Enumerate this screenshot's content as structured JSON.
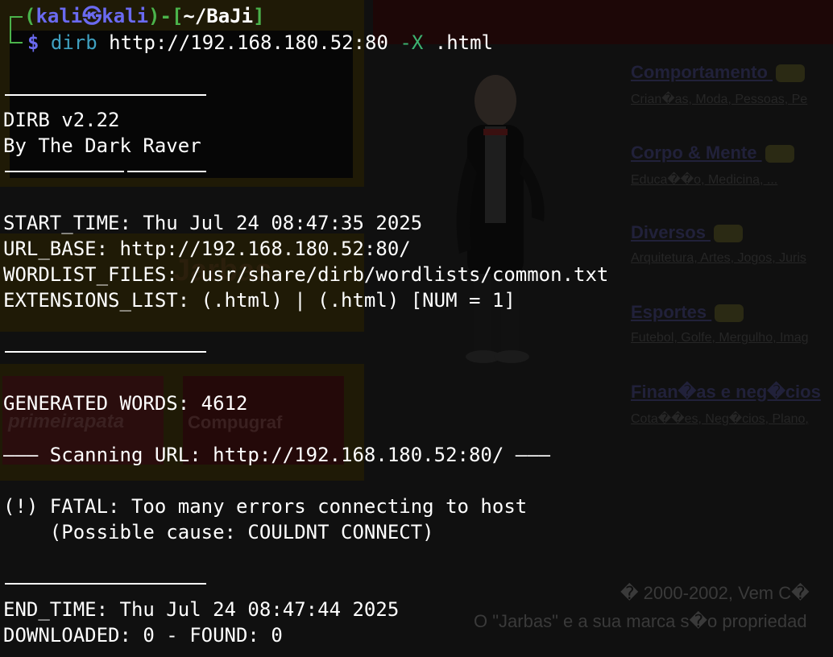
{
  "terminal": {
    "prompt": {
      "open": "┌──(",
      "user": "kali",
      "at_icon": "kali-icon",
      "host": "kali",
      "mid": ")-[",
      "path": "~/BaJi",
      "close": "]",
      "symbol": "$",
      "command": "dirb",
      "url": "http://192.168.180.52:80",
      "option": "-X",
      "option_value": ".html"
    },
    "banner": {
      "name": "DIRB v2.22",
      "author": "By The Dark Raver"
    },
    "info": {
      "start_time": "START_TIME: Thu Jul 24 08:47:35 2025",
      "url_base": "URL_BASE: http://192.168.180.52:80/",
      "wordlist": "WORDLIST_FILES: /usr/share/dirb/wordlists/common.txt",
      "extensions": "EXTENSIONS_LIST: (.html) | (.html) [NUM = 1]"
    },
    "generated": "GENERATED WORDS: 4612",
    "scanning": "——— Scanning URL: http://192.168.180.52:80/ ———",
    "fatal": "(!) FATAL: Too many errors connecting to host",
    "cause": "    (Possible cause: COULDNT CONNECT)",
    "end_time": "END_TIME: Thu Jul 24 08:47:44 2025",
    "downloaded": "DOWNLOADED: 0 - FOUND: 0"
  },
  "background_page": {
    "banners": [
      "primeirapata",
      "Compugraf"
    ],
    "categories": [
      {
        "title": "Comportamento ",
        "sub": "Crian�as, Moda, Pessoas, Pe"
      },
      {
        "title": "Corpo & Mente ",
        "sub": "Educa��o, Medicina, ..."
      },
      {
        "title": "Diversos ",
        "sub": "Arquitetura, Artes, Jogos, Juris"
      },
      {
        "title": "Esportes ",
        "sub": "Futebol, Golfe, Mergulho, Imag"
      },
      {
        "title": "Finan�as e neg�cios",
        "sub": "Cota��es, Neg�cios, Plano,"
      }
    ],
    "footer": {
      "copyright": "� 2000-2002, Vem C�",
      "trademark": "O \"Jarbas\" e a sua marca s�o propriedad"
    }
  },
  "colors": {
    "background": "#101010",
    "prompt_frame": "#4bb34b",
    "prompt_user": "#6a6af0",
    "command": "#3fa0c0",
    "text": "#ffffff"
  }
}
